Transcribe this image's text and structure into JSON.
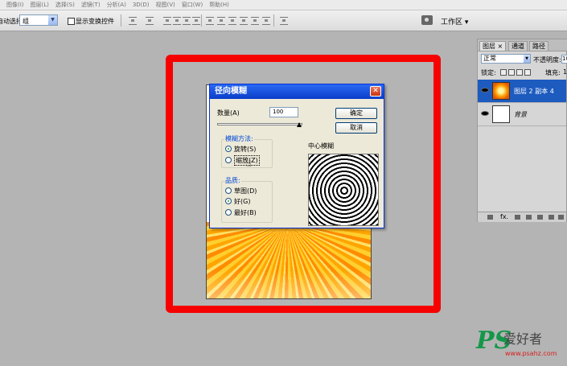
{
  "menubar": {
    "items": [
      "图像(I)",
      "图层(L)",
      "选择(S)",
      "滤镜(T)",
      "分析(A)",
      "3D(D)",
      "视图(V)",
      "窗口(W)",
      "帮助(H)"
    ]
  },
  "options_bar": {
    "auto_select_label": "自动选择:",
    "auto_select_value": "组",
    "show_transform_label": "显示变换控件",
    "workspace_label": "工作区 ▾"
  },
  "dialog": {
    "title": "径向模糊",
    "amount_label": "数量(A)",
    "amount_value": "100",
    "ok_label": "确定",
    "cancel_label": "取消",
    "method_group_label": "模糊方法:",
    "method_spin": "旋转(S)",
    "method_zoom": "缩放(Z)",
    "method_selected": "spin",
    "quality_group_label": "品质:",
    "quality_draft": "草图(D)",
    "quality_good": "好(G)",
    "quality_best": "最好(B)",
    "quality_selected": "good",
    "preview_label": "中心模糊",
    "slider_fraction": 0.96
  },
  "layers_panel": {
    "tabs": [
      "图层 ×",
      "通道",
      "路径"
    ],
    "active_tab": "图层 ×",
    "blend_mode": "正常",
    "opacity_label": "不透明度:",
    "opacity_value": "10",
    "lock_label": "锁定:",
    "fill_label": "填充:",
    "fill_value": "1",
    "layers": [
      {
        "name": "图层 2 副本 4",
        "selected": true
      },
      {
        "name": "背景",
        "selected": false
      }
    ],
    "footer_fx": "fx."
  },
  "watermark": {
    "ps": "PS",
    "cn": "爱好者",
    "url": "www.psahz.com"
  },
  "colors": {
    "frame_red": "#f60000",
    "selection_blue": "#1d5bbf",
    "title_blue": "#0a3dc8",
    "watermark_green": "#15974a"
  }
}
